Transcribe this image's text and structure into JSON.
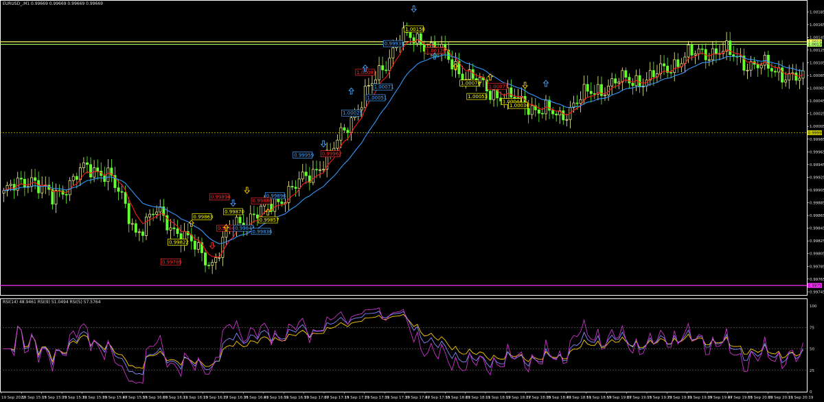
{
  "chart": {
    "symbol_info": "EURUSD_,M1  0.99669 0.99669 0.99669 0.99669",
    "price_ticks": [
      "1.00185",
      "1.00165",
      "1.00145",
      "1.00125",
      "1.00105",
      "1.00085",
      "1.00065",
      "1.00045",
      "1.00025",
      "1.00005",
      "0.99985",
      "0.99965",
      "0.99945",
      "0.99925",
      "0.99905",
      "0.99885",
      "0.99865",
      "0.99845",
      "0.99825",
      "0.99805",
      "0.99785",
      "0.99765",
      "0.99745"
    ],
    "level_tags": {
      "upper_green": "1.00134",
      "upper_yellow": "1.00138",
      "mid_yellow": "0.99995",
      "magenta": "0.99755"
    },
    "rsi_info": "RSI(14) 48.9461  RSI(9) 51.0494  RSI(5) 57.5764",
    "rsi_ticks": [
      "100",
      "75",
      "50",
      "25",
      "0"
    ],
    "time_labels": [
      "19 Sep 2022",
      "19 Sep 15:15",
      "19 Sep 15:23",
      "19 Sep 15:31",
      "19 Sep 15:39",
      "19 Sep 15:47",
      "19 Sep 15:55",
      "19 Sep 16:03",
      "19 Sep 16:11",
      "19 Sep 16:19",
      "19 Sep 16:27",
      "19 Sep 16:35",
      "19 Sep 16:43",
      "19 Sep 16:51",
      "19 Sep 16:59",
      "19 Sep 17:07",
      "19 Sep 17:15",
      "19 Sep 17:23",
      "19 Sep 17:31",
      "19 Sep 17:39",
      "19 Sep 17:47",
      "19 Sep 17:55",
      "19 Sep 18:03",
      "19 Sep 18:11",
      "19 Sep 18:19",
      "19 Sep 18:27",
      "19 Sep 18:35",
      "19 Sep 18:43",
      "19 Sep 18:51",
      "19 Sep 18:59",
      "19 Sep 19:07",
      "19 Sep 19:15",
      "19 Sep 19:23",
      "19 Sep 19:31",
      "19 Sep 19:39",
      "19 Sep 19:47",
      "19 Sep 19:55",
      "19 Sep 20:03",
      "19 Sep 20:11",
      "19 Sep 20:19"
    ],
    "price_labels": [
      {
        "text": "1.00158",
        "color": "#ffff00",
        "price": 1.00158,
        "bar": 118
      },
      {
        "text": "0.99939",
        "color": "#4aa8ff",
        "price": 1.00135,
        "bar": 112
      },
      {
        "text": "1.00129",
        "color": "#ff2a2a",
        "price": 1.00124,
        "bar": 124
      },
      {
        "text": "1.00081",
        "color": "#ff2a2a",
        "price": 1.0009,
        "bar": 104
      },
      {
        "text": "1.00078",
        "color": "#ffff00",
        "price": 1.00073,
        "bar": 134
      },
      {
        "text": "1.00071",
        "color": "#4aa8ff",
        "price": 1.00067,
        "bar": 109
      },
      {
        "text": "1.00051",
        "color": "#4aa8ff",
        "price": 1.0005,
        "bar": 107
      },
      {
        "text": "1.00075",
        "color": "#ff2a2a",
        "price": 1.00068,
        "bar": 142
      },
      {
        "text": "1.00053",
        "color": "#ffff00",
        "price": 1.00052,
        "bar": 136
      },
      {
        "text": "1.00044",
        "color": "#ffff00",
        "price": 1.00044,
        "bar": 146
      },
      {
        "text": "1.00036",
        "color": "#ffff00",
        "price": 1.00038,
        "bar": 148
      },
      {
        "text": "1.00025",
        "color": "#4aa8ff",
        "price": 1.00026,
        "bar": 100
      },
      {
        "text": "0.99959",
        "color": "#4aa8ff",
        "price": 0.9996,
        "bar": 86
      },
      {
        "text": "0.99962",
        "color": "#ff2a2a",
        "price": 0.99962,
        "bar": 94
      },
      {
        "text": "0.99896",
        "color": "#4aa8ff",
        "price": 0.99896,
        "bar": 78
      },
      {
        "text": "0.99894",
        "color": "#ff2a2a",
        "price": 0.99894,
        "bar": 62
      },
      {
        "text": "0.99880",
        "color": "#ff2a2a",
        "price": 0.99888,
        "bar": 74
      },
      {
        "text": "0.99863",
        "color": "#ffff00",
        "price": 0.99863,
        "bar": 57
      },
      {
        "text": "0.99870",
        "color": "#ffff00",
        "price": 0.99871,
        "bar": 66
      },
      {
        "text": "0.99857",
        "color": "#ffff00",
        "price": 0.99858,
        "bar": 76
      },
      {
        "text": "0.99843",
        "color": "#ff2a2a",
        "price": 0.99845,
        "bar": 64
      },
      {
        "text": "0.99844",
        "color": "#4aa8ff",
        "price": 0.99845,
        "bar": 69
      },
      {
        "text": "0.99836",
        "color": "#4aa8ff",
        "price": 0.9984,
        "bar": 74
      },
      {
        "text": "0.99822",
        "color": "#ffff00",
        "price": 0.99823,
        "bar": 50
      },
      {
        "text": "0.99789",
        "color": "#ff2a2a",
        "price": 0.99792,
        "bar": 48
      }
    ],
    "colors": {
      "background": "#000000",
      "bull_candle": "#ffff99",
      "bear_candle": "#66ff33",
      "ma_fast": "#ff1a1a",
      "ma_slow": "#3399ff",
      "rsi14": "#ffcc00",
      "rsi9": "#8888ff",
      "rsi5": "#cc33cc",
      "level_green": "#b3ff66",
      "level_yellow": "#ffff66",
      "level_magenta": "#ff33ff"
    }
  }
}
